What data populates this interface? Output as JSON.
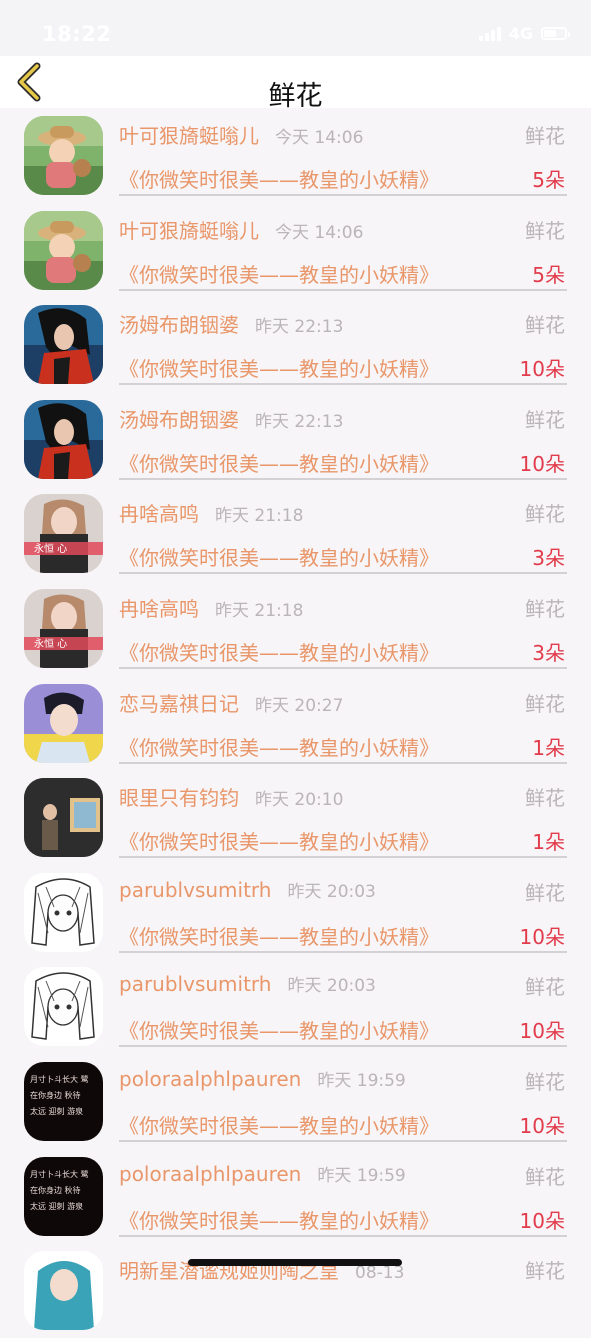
{
  "status_bar": {
    "time": "18:22",
    "network": "4G"
  },
  "nav": {
    "title": "鲜花"
  },
  "rows": [
    {
      "name": "叶可狠旖蜓嗡儿",
      "time": "今天 14:06",
      "type": "鲜花",
      "work": "《你微笑时很美——教皇的小妖精》",
      "count": "5朵",
      "avatar": "cartoon-farmer-avatar"
    },
    {
      "name": "叶可狠旖蜓嗡儿",
      "time": "今天 14:06",
      "type": "鲜花",
      "work": "《你微笑时很美——教皇的小妖精》",
      "count": "5朵",
      "avatar": "cartoon-farmer-avatar"
    },
    {
      "name": "汤姆布朗铟婆",
      "time": "昨天 22:13",
      "type": "鲜花",
      "work": "《你微笑时很美——教皇的小妖精》",
      "count": "10朵",
      "avatar": "anime-warrior-avatar"
    },
    {
      "name": "汤姆布朗铟婆",
      "time": "昨天 22:13",
      "type": "鲜花",
      "work": "《你微笑时很美——教皇的小妖精》",
      "count": "10朵",
      "avatar": "anime-warrior-avatar"
    },
    {
      "name": "冉啥高鸣",
      "time": "昨天 21:18",
      "type": "鲜花",
      "work": "《你微笑时很美——教皇的小妖精》",
      "count": "3朵",
      "avatar": "girl-photo-avatar"
    },
    {
      "name": "冉啥高鸣",
      "time": "昨天 21:18",
      "type": "鲜花",
      "work": "《你微笑时很美——教皇的小妖精》",
      "count": "3朵",
      "avatar": "girl-photo-avatar"
    },
    {
      "name": "恋马嘉祺日记",
      "time": "昨天 20:27",
      "type": "鲜花",
      "work": "《你微笑时很美——教皇的小妖精》",
      "count": "1朵",
      "avatar": "boy-photo-avatar"
    },
    {
      "name": "眼里只有钧钧",
      "time": "昨天 20:10",
      "type": "鲜花",
      "work": "《你微笑时很美——教皇的小妖精》",
      "count": "1朵",
      "avatar": "gallery-photo-avatar"
    },
    {
      "name": "parublvsumitrh",
      "time": "昨天 20:03",
      "type": "鲜花",
      "work": "《你微笑时很美——教皇的小妖精》",
      "count": "10朵",
      "avatar": "manga-girl-avatar"
    },
    {
      "name": "parublvsumitrh",
      "time": "昨天 20:03",
      "type": "鲜花",
      "work": "《你微笑时很美——教皇的小妖精》",
      "count": "10朵",
      "avatar": "manga-girl-avatar"
    },
    {
      "name": "poloraalphlpauren",
      "time": "昨天 19:59",
      "type": "鲜花",
      "work": "《你微笑时很美——教皇的小妖精》",
      "count": "10朵",
      "avatar": "dark-text-avatar"
    },
    {
      "name": "poloraalphlpauren",
      "time": "昨天 19:59",
      "type": "鲜花",
      "work": "《你微笑时很美——教皇的小妖精》",
      "count": "10朵",
      "avatar": "dark-text-avatar"
    },
    {
      "name": "明新星潜谧规姬则陶之皇",
      "time": "08-13",
      "type": "鲜花",
      "work": "",
      "count": "",
      "avatar": "teal-character-avatar"
    }
  ],
  "colors": {
    "name_orange": "#e9976a",
    "count_red": "#e23b4b",
    "meta_gray": "#b9b5b8",
    "back_yellow": "#e5c84a"
  }
}
